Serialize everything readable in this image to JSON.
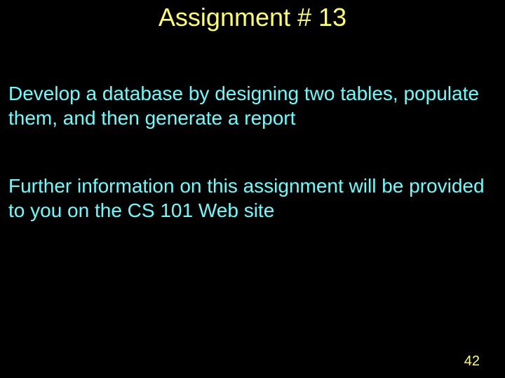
{
  "title": "Assignment # 13",
  "paragraph1": "Develop a database by designing two tables, populate them, and then generate a report",
  "paragraph2": "Further information on this assignment will be provided to you on the CS 101 Web site",
  "pageNumber": "42"
}
